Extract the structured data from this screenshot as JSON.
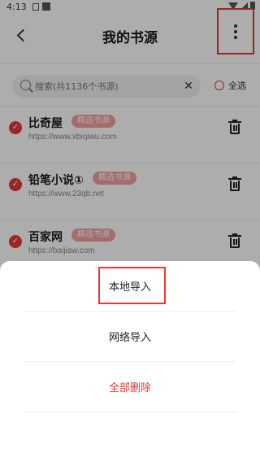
{
  "status_bar": {
    "time": "4:13"
  },
  "header": {
    "title": "我的书源"
  },
  "search": {
    "placeholder": "搜索(共1136个书源)",
    "clear_symbol": "✕",
    "select_all_label": "全选"
  },
  "sources": [
    {
      "name": "比奇屋",
      "badge": "精选书源",
      "url": "https://www.xbiqiwu.com",
      "checked": true
    },
    {
      "name": "铅笔小说①",
      "badge": "精选书源",
      "url": "https://www.23qb.net",
      "checked": true
    },
    {
      "name": "百家网",
      "badge": "精选书源",
      "url": "https://baijiaw.com",
      "checked": true
    }
  ],
  "menu": {
    "local_import": "本地导入",
    "network_import": "网络导入",
    "delete_all": "全部删除"
  },
  "colors": {
    "accent": "#e53935",
    "badge": "#f2a0a0",
    "overlay": "rgba(0,0,0,0.32)"
  },
  "icons": [
    "back-icon",
    "more-vertical-icon",
    "search-icon",
    "clear-icon",
    "radio-icon",
    "check-icon",
    "trash-icon"
  ]
}
